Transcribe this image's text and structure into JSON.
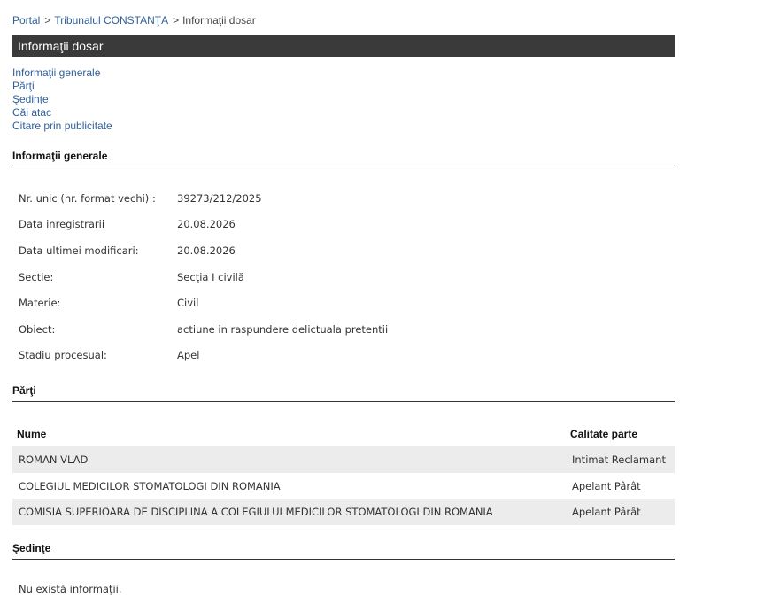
{
  "breadcrumb": {
    "portal": "Portal",
    "separator": ">",
    "court": "Tribunalul CONSTANŢA",
    "current": "Informaţii dosar"
  },
  "page_title": "Informaţii dosar",
  "anchors": {
    "general": "Informaţii generale",
    "parti": "Părţi",
    "sedinte": "Şedinţe",
    "cai_atac": "Căi atac",
    "citare": "Citare prin publicitate"
  },
  "general": {
    "heading": "Informaţii generale",
    "rows": [
      {
        "label": "Nr. unic (nr. format vechi) :",
        "value": "39273/212/2025"
      },
      {
        "label": "Data inregistrarii",
        "value": "20.08.2026"
      },
      {
        "label": "Data ultimei modificari:",
        "value": "20.08.2026"
      },
      {
        "label": "Sectie:",
        "value": "Secţia I civilă"
      },
      {
        "label": "Materie:",
        "value": "Civil"
      },
      {
        "label": "Obiect:",
        "value": "actiune in raspundere delictuala pretentii"
      },
      {
        "label": "Stadiu procesual:",
        "value": "Apel"
      }
    ]
  },
  "parti": {
    "heading": "Părţi",
    "columns": [
      "Nume",
      "Calitate parte"
    ],
    "rows": [
      {
        "name": "ROMAN VLAD",
        "role": "Intimat Reclamant"
      },
      {
        "name": "COLEGIUL MEDICILOR STOMATOLOGI DIN ROMANIA",
        "role": "Apelant Pârât"
      },
      {
        "name": "COMISIA SUPERIOARA DE DISCIPLINA A COLEGIULUI MEDICILOR STOMATOLOGI DIN ROMANIA",
        "role": "Apelant Pârât"
      }
    ]
  },
  "sedinte": {
    "heading": "Şedinţe",
    "empty_text": "Nu există informaţii."
  },
  "colors": {
    "link": "#2f5f9a",
    "title_bar": "#3a3a3a",
    "row_alt": "#ececec"
  }
}
